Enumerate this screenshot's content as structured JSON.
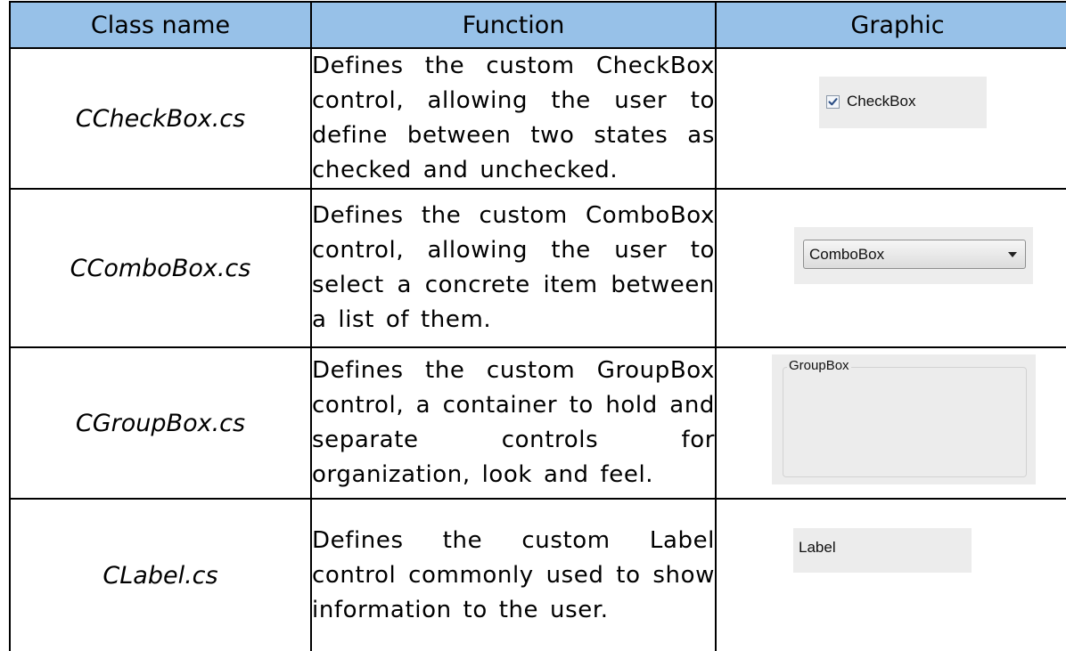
{
  "table": {
    "headers": {
      "class_name": "Class name",
      "function": "Function",
      "graphic": "Graphic"
    },
    "header_color": "#97c1e8",
    "rows": [
      {
        "class_name": "CCheckBox.cs",
        "function": "Defines the custom CheckBox control, allowing the user to define between two states as checked and unchecked.",
        "graphic": {
          "type": "checkbox",
          "label": "CheckBox",
          "checked": true,
          "icon": "checkmark-icon"
        }
      },
      {
        "class_name": "CComboBox.cs",
        "function": "Defines the custom ComboBox control, allowing the user to select a concrete item between a list of them.",
        "graphic": {
          "type": "combobox",
          "label": "ComboBox",
          "icon": "dropdown-arrow-icon"
        }
      },
      {
        "class_name": "CGroupBox.cs",
        "function": "Defines the custom GroupBox control, a container to hold and separate controls for organization, look and feel.",
        "graphic": {
          "type": "groupbox",
          "label": "GroupBox"
        }
      },
      {
        "class_name": "CLabel.cs",
        "function": "Defines the custom Label control commonly used to show information to the user.",
        "graphic": {
          "type": "label",
          "label": "Label"
        }
      }
    ]
  }
}
